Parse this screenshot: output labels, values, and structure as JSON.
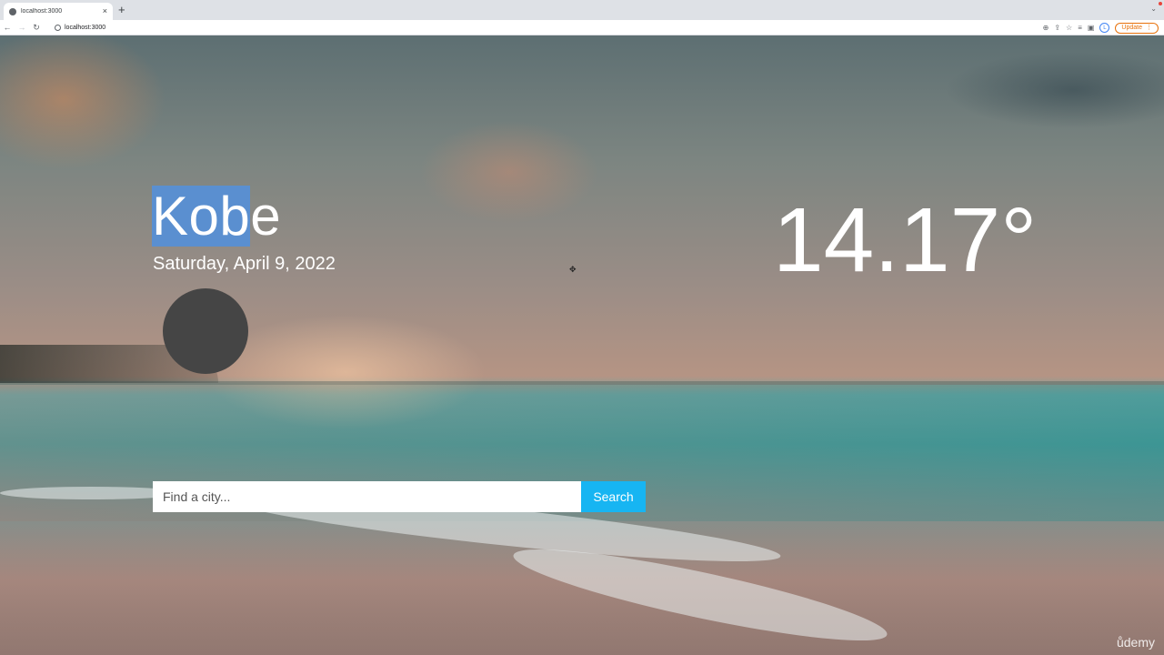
{
  "browser": {
    "tab_title": "localhost:3000",
    "tab_close": "×",
    "new_tab": "+",
    "address": "localhost:3000",
    "update_label": "Update",
    "profile_initial": "L",
    "icons": [
      "back-icon",
      "forward-icon",
      "reload-icon",
      "info-icon",
      "zoom-icon",
      "share-icon",
      "bookmark-star-icon",
      "reading-list-icon",
      "sidebar-icon",
      "profile-icon",
      "menu-icon"
    ]
  },
  "weather": {
    "city_selected": "Kob",
    "city_rest": "e",
    "date": "Saturday, April 9, 2022",
    "temperature": "14.17°",
    "icon": "weather-icon-placeholder",
    "icon_color": "#454545"
  },
  "search": {
    "placeholder": "Find a city...",
    "value": "",
    "button_label": "Search",
    "button_color": "#17b5f2"
  },
  "watermark": "ůdemy",
  "colors": {
    "selection": "#5a8fd0",
    "update_accent": "#e8710a"
  }
}
